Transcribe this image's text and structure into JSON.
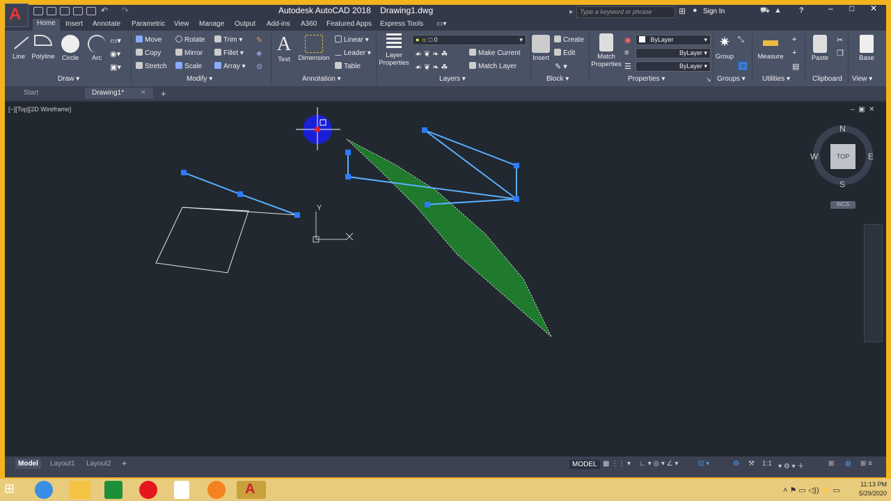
{
  "window": {
    "app": "Autodesk AutoCAD 2018",
    "file": "Drawing1.dwg"
  },
  "search": {
    "placeholder": "Type a keyword or phrase"
  },
  "account": {
    "signin": "Sign In"
  },
  "menu_tabs": [
    "Home",
    "Insert",
    "Annotate",
    "Parametric",
    "View",
    "Manage",
    "Output",
    "Add-ins",
    "A360",
    "Featured Apps",
    "Express Tools"
  ],
  "draw": {
    "line": "Line",
    "polyline": "Polyline",
    "circle": "Circle",
    "arc": "Arc",
    "label": "Draw"
  },
  "modify": {
    "move": "Move",
    "rotate": "Rotate",
    "trim": "Trim",
    "copy": "Copy",
    "mirror": "Mirror",
    "fillet": "Fillet",
    "stretch": "Stretch",
    "scale": "Scale",
    "array": "Array",
    "label": "Modify"
  },
  "annotation": {
    "text": "Text",
    "dimension": "Dimension",
    "linear": "Linear",
    "leader": "Leader",
    "table": "Table",
    "label": "Annotation"
  },
  "layers": {
    "layer_properties": "Layer Properties",
    "current_layer": "0",
    "make_current": "Make Current",
    "match_layer": "Match Layer",
    "label": "Layers"
  },
  "block": {
    "insert": "Insert",
    "create": "Create",
    "edit": "Edit",
    "label": "Block"
  },
  "properties": {
    "match": "Match Properties",
    "color": "ByLayer",
    "linetype": "ByLayer",
    "lineweight": "ByLayer",
    "label": "Properties"
  },
  "groups": {
    "group": "Group",
    "label": "Groups"
  },
  "utilities": {
    "measure": "Measure",
    "label": "Utilities"
  },
  "clipboard": {
    "paste": "Paste",
    "label": "Clipboard"
  },
  "view": {
    "base": "Base",
    "label": "View"
  },
  "file_tabs": {
    "start": "Start",
    "drawing": "Drawing1*"
  },
  "viewport": {
    "label": "[−][Top][2D Wireframe]"
  },
  "viewcube": {
    "n": "N",
    "s": "S",
    "e": "E",
    "w": "W",
    "top": "TOP",
    "wcs": "WCS"
  },
  "ucs": {
    "y": "Y"
  },
  "layout_tabs": {
    "model": "Model",
    "layout1": "Layout1",
    "layout2": "Layout2"
  },
  "status": {
    "model": "MODEL",
    "scale": "1:1"
  },
  "clock": {
    "time": "11:13 PM",
    "date": "5/29/2020"
  },
  "colors": {
    "fill": "#1f7a2e",
    "grip": "#2b7bff",
    "select": "#5ab0ff"
  }
}
